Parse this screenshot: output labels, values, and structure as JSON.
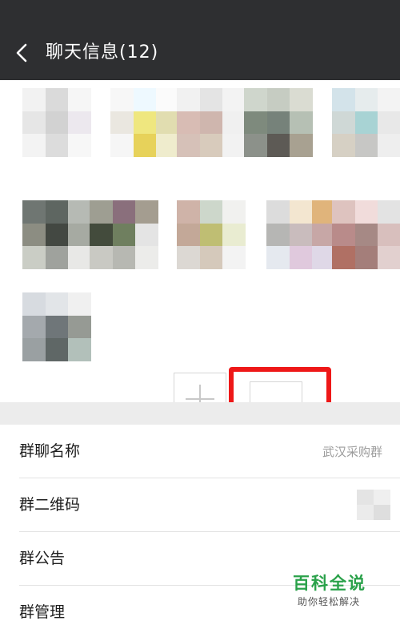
{
  "header": {
    "back_icon": "chevron-left-icon",
    "title": "聊天信息(12)"
  },
  "members": {
    "avatars": [
      {
        "name": "member-1",
        "colors": [
          "#f2f2f2",
          "#dadada",
          "#f6f6f6",
          "#e6e6e6",
          "#d2d2d2",
          "#ece8ee",
          "#f3f3f3",
          "#dcdcdc",
          "#f7f7f7"
        ]
      },
      {
        "name": "member-2",
        "colors": [
          "#f7f7f7",
          "#eef9ff",
          "#fbfbfb",
          "#eae7e0",
          "#efe77f",
          "#e1ddb0",
          "#f6f6f6",
          "#e7d25a",
          "#efeccd"
        ]
      },
      {
        "name": "member-3",
        "colors": [
          "#f1f1f1",
          "#e4e4e4",
          "#f3f3f3",
          "#d8bcb4",
          "#cfb6ae",
          "#f0f0f0",
          "#d6c1b8",
          "#d8cbbc",
          "#f2f2f2"
        ]
      },
      {
        "name": "member-4",
        "colors": [
          "#cfd6cc",
          "#c6ccc2",
          "#dadcd2",
          "#7e8a7d",
          "#76827a",
          "#b6c0b4",
          "#8c918a",
          "#5d5a55",
          "#a8a191"
        ]
      },
      {
        "name": "member-5",
        "colors": [
          "#d3e3ea",
          "#e6eced",
          "#f3f3f3",
          "#cfd8d6",
          "#a8d3d4",
          "#e8e8e8",
          "#d6d0c4",
          "#c7c7c5",
          "#eeeeee"
        ]
      },
      {
        "name": "member-6",
        "colors": [
          "#6f7672",
          "#5e6661",
          "#b6bab4",
          "#8c8d82",
          "#434842",
          "#a6aaa2",
          "#cacdc5",
          "#9fa29d",
          "#e8e8e6"
        ]
      },
      {
        "name": "member-7",
        "colors": [
          "#9e9e92",
          "#8a6f7c",
          "#a49d90",
          "#434b3c",
          "#6f7f5f",
          "#e4e4e4",
          "#c9c9c3",
          "#b7b8b2",
          "#ececea"
        ]
      },
      {
        "name": "member-8",
        "colors": [
          "#cfb3a8",
          "#cdd7cb",
          "#f1f1ef",
          "#c3a898",
          "#bfbe73",
          "#e9ecd1",
          "#dcd8d3",
          "#d5c9bb",
          "#f3f3f3"
        ]
      },
      {
        "name": "member-9",
        "colors": [
          "#dcdcdc",
          "#f3e6d0",
          "#e0b47b",
          "#b6b6b4",
          "#c9bcbd",
          "#c7a7a6",
          "#e5e9ef",
          "#e0c9dd",
          "#dfd8e7"
        ]
      },
      {
        "name": "member-10",
        "colors": [
          "#dec3bf",
          "#f1dcdb",
          "#e3e3e3",
          "#b98b8a",
          "#a68985",
          "#d8bfbd",
          "#b07064",
          "#a47e7a",
          "#e2d0cf"
        ]
      },
      {
        "name": "member-11",
        "colors": [
          "#d7dbe0",
          "#e2e5e8",
          "#f0f0f0",
          "#a4a9ad",
          "#6f7679",
          "#969a94",
          "#9aa0a2",
          "#5f6766",
          "#b2c0ba"
        ]
      }
    ],
    "add_button": {
      "label": "+",
      "icon": "plus-icon"
    },
    "remove_button": {
      "label": "—",
      "icon": "minus-icon"
    },
    "highlight_color": "#ee1818"
  },
  "settings": {
    "rows": [
      {
        "label": "群聊名称",
        "value": "武汉采购群"
      },
      {
        "label": "群二维码",
        "value": ""
      },
      {
        "label": "群公告",
        "value": ""
      },
      {
        "label": "群管理",
        "value": ""
      }
    ]
  },
  "watermark": {
    "title": "百科全说",
    "subtitle": "助你轻松解决",
    "color": "#2aa14a"
  }
}
